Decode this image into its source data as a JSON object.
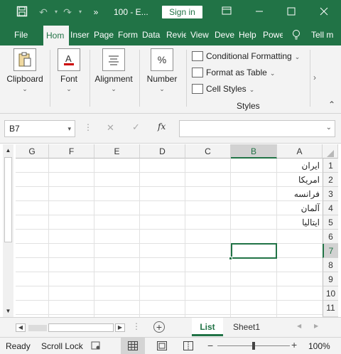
{
  "titlebar": {
    "doc_title": "100 - E...",
    "sign_in": "Sign in",
    "redo_count": "..."
  },
  "tabs": [
    "File",
    "Hom",
    "Inser",
    "Page",
    "Form",
    "Data",
    "Revie",
    "View",
    "Deve",
    "Help",
    "Powe",
    "Tell m"
  ],
  "ribbon": {
    "clipboard": "Clipboard",
    "font": "Font",
    "alignment": "Alignment",
    "number": "Number",
    "number_icon": "%",
    "conditional_formatting": "Conditional Formatting",
    "format_as_table": "Format as Table",
    "cell_styles": "Cell Styles",
    "styles_group": "Styles"
  },
  "formula_bar": {
    "name_box": "B7",
    "fx": "fx",
    "value": ""
  },
  "columns": [
    "G",
    "F",
    "E",
    "D",
    "C",
    "B",
    "A"
  ],
  "rows": [
    "1",
    "2",
    "3",
    "4",
    "5",
    "6",
    "7",
    "8",
    "9",
    "10",
    "11"
  ],
  "cells_A": [
    "ایران",
    "امریکا",
    "فرانسه",
    "آلمان",
    "ایتالیا"
  ],
  "sheets": {
    "active": "List",
    "other": "Sheet1"
  },
  "status": {
    "ready": "Ready",
    "scroll_lock": "Scroll Lock",
    "zoom": "100%"
  },
  "colors": {
    "accent": "#217346"
  }
}
